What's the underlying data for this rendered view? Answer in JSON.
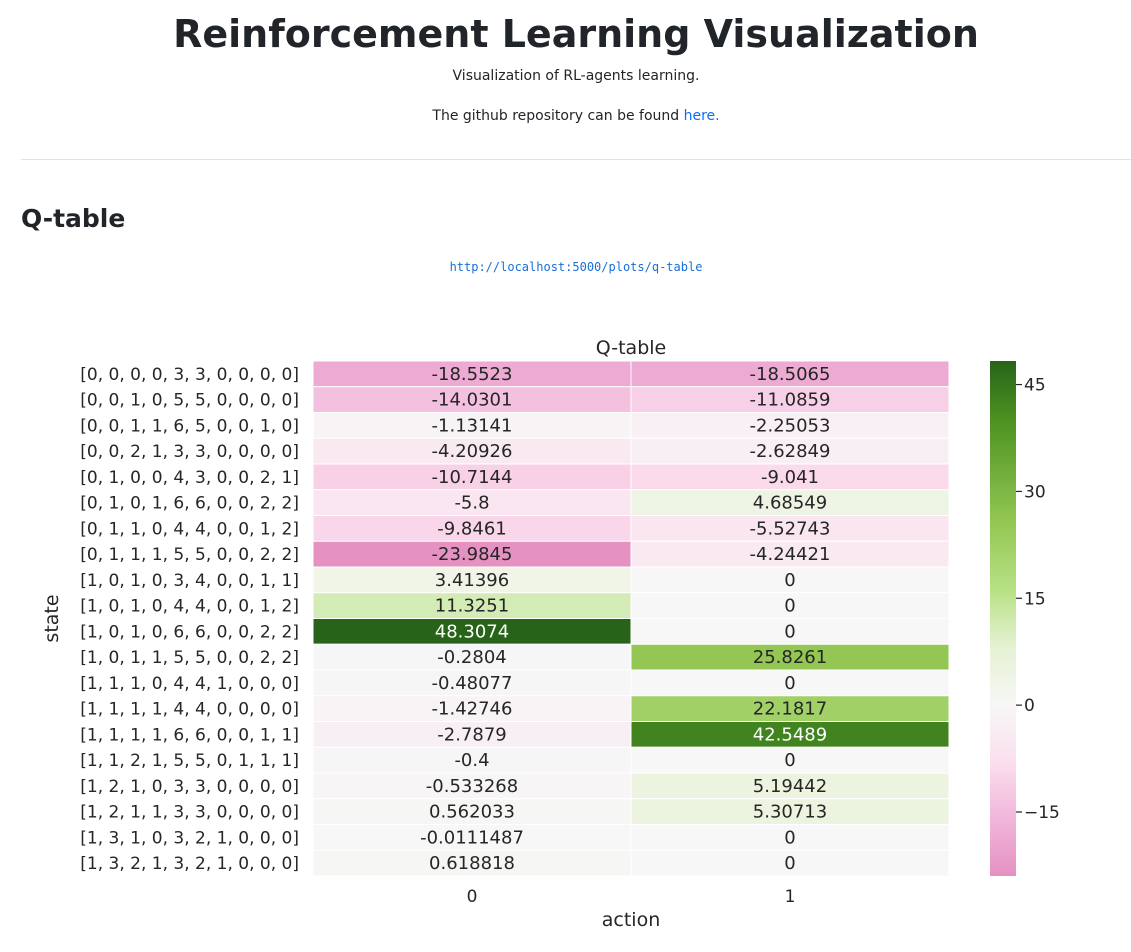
{
  "header": {
    "title": "Reinforcement Learning Visualization",
    "subtitle": "Visualization of RL-agents learning.",
    "repo_text": "The github repository can be found ",
    "repo_link_label": "here."
  },
  "section": {
    "title": "Q-table",
    "plot_url": "http://localhost:5000/plots/q-table"
  },
  "chart_data": {
    "type": "heatmap",
    "title": "Q-table",
    "xlabel": "action",
    "ylabel": "state",
    "x_categories": [
      "0",
      "1"
    ],
    "y_categories": [
      "[0, 0, 0, 0, 3, 3, 0, 0, 0, 0]",
      "[0, 0, 1, 0, 5, 5, 0, 0, 0, 0]",
      "[0, 0, 1, 1, 6, 5, 0, 0, 1, 0]",
      "[0, 0, 2, 1, 3, 3, 0, 0, 0, 0]",
      "[0, 1, 0, 0, 4, 3, 0, 0, 2, 1]",
      "[0, 1, 0, 1, 6, 6, 0, 0, 2, 2]",
      "[0, 1, 1, 0, 4, 4, 0, 0, 1, 2]",
      "[0, 1, 1, 1, 5, 5, 0, 0, 2, 2]",
      "[1, 0, 1, 0, 3, 4, 0, 0, 1, 1]",
      "[1, 0, 1, 0, 4, 4, 0, 0, 1, 2]",
      "[1, 0, 1, 0, 6, 6, 0, 0, 2, 2]",
      "[1, 0, 1, 1, 5, 5, 0, 0, 2, 2]",
      "[1, 1, 1, 0, 4, 4, 1, 0, 0, 0]",
      "[1, 1, 1, 1, 4, 4, 0, 0, 0, 0]",
      "[1, 1, 1, 1, 6, 6, 0, 0, 1, 1]",
      "[1, 1, 2, 1, 5, 5, 0, 1, 1, 1]",
      "[1, 2, 1, 0, 3, 3, 0, 0, 0, 0]",
      "[1, 2, 1, 1, 3, 3, 0, 0, 0, 0]",
      "[1, 3, 1, 0, 3, 2, 1, 0, 0, 0]",
      "[1, 3, 2, 1, 3, 2, 1, 0, 0, 0]"
    ],
    "values": [
      [
        -18.5523,
        -18.5065
      ],
      [
        -14.0301,
        -11.0859
      ],
      [
        -1.13141,
        -2.25053
      ],
      [
        -4.20926,
        -2.62849
      ],
      [
        -10.7144,
        -9.041
      ],
      [
        -5.8,
        4.68549
      ],
      [
        -9.8461,
        -5.52743
      ],
      [
        -23.9845,
        -4.24421
      ],
      [
        3.41396,
        0
      ],
      [
        11.3251,
        0
      ],
      [
        48.3074,
        0
      ],
      [
        -0.2804,
        25.8261
      ],
      [
        -0.48077,
        0
      ],
      [
        -1.42746,
        22.1817
      ],
      [
        -2.7879,
        42.5489
      ],
      [
        -0.4,
        0
      ],
      [
        -0.533268,
        5.19442
      ],
      [
        0.562033,
        5.30713
      ],
      [
        -0.0111487,
        0
      ],
      [
        0.618818,
        0
      ]
    ],
    "labels": [
      [
        "-18.5523",
        "-18.5065"
      ],
      [
        "-14.0301",
        "-11.0859"
      ],
      [
        "-1.13141",
        "-2.25053"
      ],
      [
        "-4.20926",
        "-2.62849"
      ],
      [
        "-10.7144",
        "-9.041"
      ],
      [
        "-5.8",
        "4.68549"
      ],
      [
        "-9.8461",
        "-5.52743"
      ],
      [
        "-23.9845",
        "-4.24421"
      ],
      [
        "3.41396",
        "0"
      ],
      [
        "11.3251",
        "0"
      ],
      [
        "48.3074",
        "0"
      ],
      [
        "-0.2804",
        "25.8261"
      ],
      [
        "-0.48077",
        "0"
      ],
      [
        "-1.42746",
        "22.1817"
      ],
      [
        "-2.7879",
        "42.5489"
      ],
      [
        "-0.4",
        "0"
      ],
      [
        "-0.533268",
        "5.19442"
      ],
      [
        "0.562033",
        "5.30713"
      ],
      [
        "-0.0111487",
        "0"
      ],
      [
        "0.618818",
        "0"
      ]
    ],
    "colormap": "PiYG",
    "vmin": -23.9845,
    "vmax": 48.3074,
    "center": 0,
    "colorbar_ticks": [
      45,
      30,
      15,
      0,
      -15
    ],
    "colorbar_tick_labels": [
      "45",
      "30",
      "15",
      "0",
      "−15"
    ],
    "colorbar_stops": [
      {
        "value": -23.9845,
        "color": "#e591c2"
      },
      {
        "value": -16,
        "color": "#f1b6da"
      },
      {
        "value": -8,
        "color": "#fbdfee"
      },
      {
        "value": 0,
        "color": "#f7f7f7"
      },
      {
        "value": 8,
        "color": "#e6f2d4"
      },
      {
        "value": 16,
        "color": "#b8e186"
      },
      {
        "value": 26,
        "color": "#92c652"
      },
      {
        "value": 40,
        "color": "#4d9221"
      },
      {
        "value": 48.3074,
        "color": "#276419"
      }
    ],
    "grid_color": "#ffffff"
  }
}
